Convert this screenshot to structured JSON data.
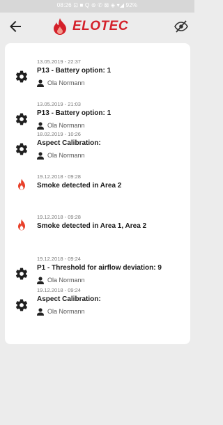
{
  "status_bar": {
    "text": "08:26 ⊡ ■ Q    ⊚ ✆ ⊠ ◈ ▾◢ 92%"
  },
  "app_bar": {
    "logo_text": "ELOTEC",
    "brand_color": "#d4202a",
    "back_icon": "arrow-left-icon",
    "visibility_icon": "eye-off-icon"
  },
  "events": [
    {
      "time": "13.05.2019 - 22:37",
      "title": "P13 - Battery option: 1",
      "user": "Ola Normann",
      "icon": "gear-icon"
    },
    {
      "time": "13.05.2019 - 21:03",
      "title": "P13 - Battery option: 1",
      "user": "Ola Normann",
      "icon": "gear-icon"
    },
    {
      "time": "18.02.2019 - 10:26",
      "title": "Aspect Calibration:",
      "user": "Ola Normann",
      "icon": "gear-icon"
    },
    {
      "time": "19.12.2018 - 09:28",
      "title": "Smoke detected in Area 2",
      "user": "",
      "icon": "flame-icon"
    },
    {
      "time": "19.12.2018 - 09:28",
      "title": "Smoke detected in Area 1, Area 2",
      "user": "",
      "icon": "flame-icon"
    },
    {
      "time": "19.12.2018 - 09:24",
      "title": "P1 - Threshold for airflow deviation: 9",
      "user": "Ola Normann",
      "icon": "gear-icon"
    },
    {
      "time": "19.12.2018 - 09:24",
      "title": "Aspect Calibration:",
      "user": "Ola Normann",
      "icon": "gear-icon"
    }
  ]
}
